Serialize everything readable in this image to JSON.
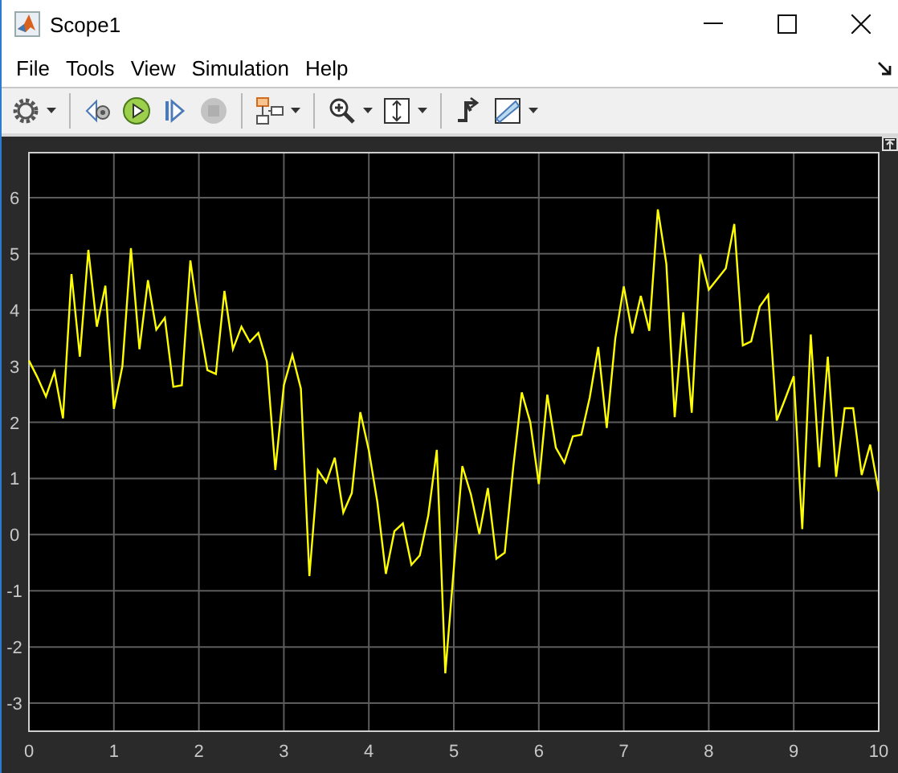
{
  "window": {
    "title": "Scope1"
  },
  "menu": [
    {
      "label": "File"
    },
    {
      "label": "Tools"
    },
    {
      "label": "View"
    },
    {
      "label": "Simulation"
    },
    {
      "label": "Help"
    }
  ],
  "toolbar": [
    {
      "kind": "settings",
      "dropdown": true,
      "disabled": false
    },
    {
      "kind": "separator"
    },
    {
      "kind": "step-back",
      "dropdown": false,
      "disabled": false
    },
    {
      "kind": "run",
      "dropdown": false,
      "disabled": false
    },
    {
      "kind": "step-forward",
      "dropdown": false,
      "disabled": false
    },
    {
      "kind": "stop",
      "dropdown": false,
      "disabled": true
    },
    {
      "kind": "separator"
    },
    {
      "kind": "signal-selector",
      "dropdown": true,
      "disabled": false
    },
    {
      "kind": "separator"
    },
    {
      "kind": "zoom",
      "dropdown": true,
      "disabled": false
    },
    {
      "kind": "scale-axes",
      "dropdown": true,
      "disabled": false
    },
    {
      "kind": "separator"
    },
    {
      "kind": "triggers",
      "dropdown": false,
      "disabled": false
    },
    {
      "kind": "measurements",
      "dropdown": true,
      "disabled": false
    }
  ],
  "scope": {
    "chart_data": {
      "type": "line",
      "grid": true,
      "xlim": [
        0,
        10
      ],
      "ylim": [
        -3.5,
        6.8
      ],
      "xticks": [
        0,
        1,
        2,
        3,
        4,
        5,
        6,
        7,
        8,
        9,
        10
      ],
      "yticks": [
        -3,
        -2,
        -1,
        0,
        1,
        2,
        3,
        4,
        5,
        6
      ],
      "x": [
        0,
        0.1,
        0.2,
        0.3,
        0.4,
        0.5,
        0.6,
        0.7,
        0.8,
        0.9,
        1,
        1.1,
        1.2,
        1.3,
        1.4,
        1.5,
        1.6,
        1.7,
        1.8,
        1.9,
        2,
        2.1,
        2.2,
        2.3,
        2.4,
        2.5,
        2.6,
        2.7,
        2.8,
        2.9,
        3,
        3.1,
        3.2,
        3.3,
        3.4,
        3.5,
        3.6,
        3.7,
        3.8,
        3.9,
        4,
        4.1,
        4.2,
        4.3,
        4.4,
        4.5,
        4.6,
        4.7,
        4.8,
        4.9,
        5,
        5.1,
        5.2,
        5.3,
        5.4,
        5.5,
        5.6,
        5.7,
        5.8,
        5.9,
        6,
        6.1,
        6.2,
        6.3,
        6.4,
        6.5,
        6.6,
        6.7,
        6.8,
        6.9,
        7,
        7.1,
        7.2,
        7.3,
        7.4,
        7.5,
        7.6,
        7.7,
        7.8,
        7.9,
        8,
        8.1,
        8.2,
        8.3,
        8.4,
        8.5,
        8.6,
        8.7,
        8.8,
        8.9,
        9,
        9.1,
        9.2,
        9.3,
        9.4,
        9.5,
        9.6,
        9.7,
        9.8,
        9.9,
        10
      ],
      "series": [
        {
          "color": "#ffff00",
          "values": [
            3.1,
            2.8,
            2.46,
            2.9,
            2.07,
            4.64,
            3.17,
            5.07,
            3.7,
            4.43,
            2.24,
            3.0,
            5.1,
            3.3,
            4.53,
            3.65,
            3.86,
            2.63,
            2.66,
            4.88,
            3.8,
            2.93,
            2.86,
            4.34,
            3.3,
            3.7,
            3.43,
            3.59,
            3.08,
            1.15,
            2.66,
            3.2,
            2.6,
            -0.74,
            1.15,
            0.93,
            1.37,
            0.39,
            0.74,
            2.18,
            1.5,
            0.58,
            -0.7,
            0.06,
            0.2,
            -0.54,
            -0.37,
            0.34,
            1.51,
            -2.47,
            -0.6,
            1.22,
            0.72,
            0.01,
            0.83,
            -0.43,
            -0.32,
            1.2,
            2.53,
            2.0,
            0.9,
            2.49,
            1.55,
            1.28,
            1.75,
            1.78,
            2.44,
            3.34,
            1.9,
            3.49,
            4.42,
            3.58,
            4.25,
            3.63,
            5.79,
            4.82,
            2.09,
            3.96,
            2.17,
            4.99,
            4.36,
            4.55,
            4.74,
            5.53,
            3.37,
            3.44,
            4.06,
            4.27,
            2.03,
            2.42,
            2.82,
            0.1,
            3.56,
            1.2,
            3.17,
            1.03,
            2.25,
            2.25,
            1.06,
            1.6,
            0.77
          ]
        }
      ]
    }
  }
}
